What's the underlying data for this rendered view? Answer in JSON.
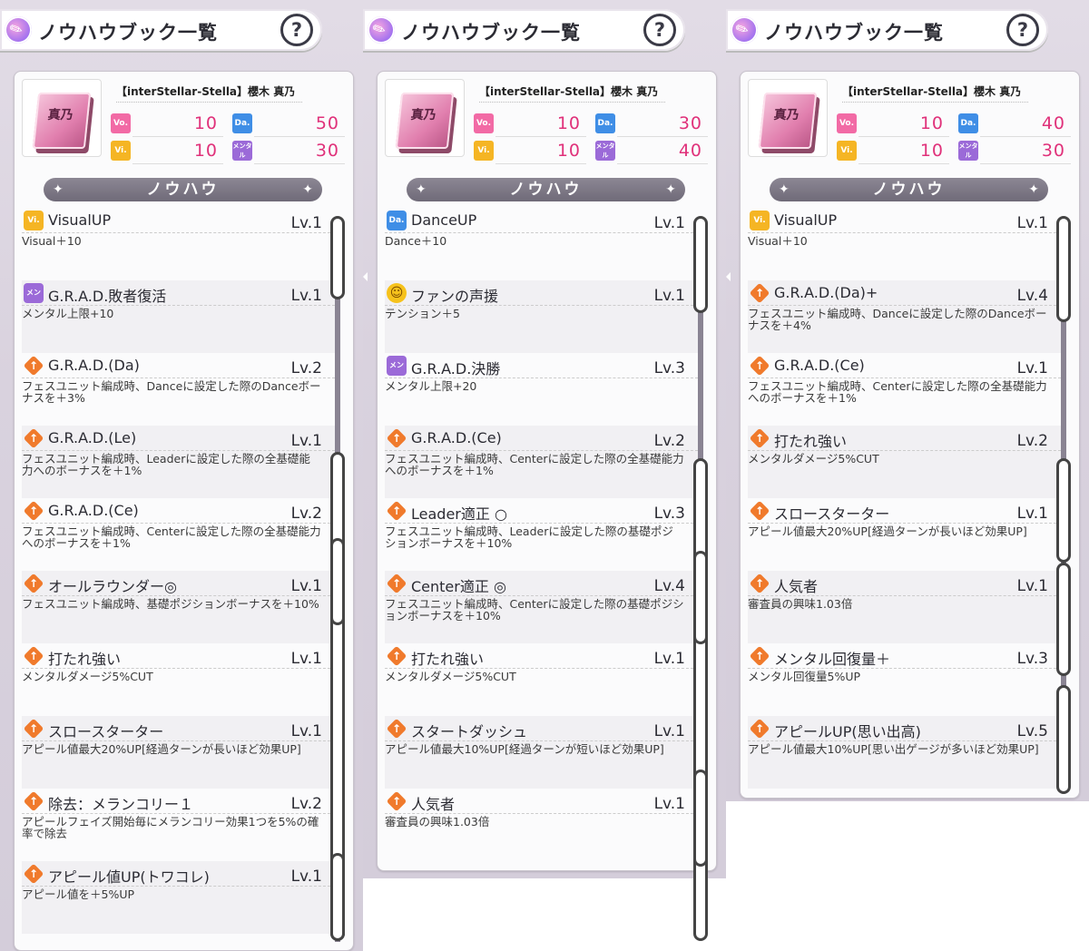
{
  "screen_title": "ノウハウブック一覧",
  "help_label": "?",
  "section_label": "ノウハウ",
  "stat_labels": {
    "vo": "Vo.",
    "da": "Da.",
    "vi": "Vi.",
    "me": "メンタル"
  },
  "colors": {
    "vocal": "#f26aa5",
    "dance": "#3f8ee6",
    "visual": "#f5b524",
    "mental": "#9b6ad8",
    "value": "#e0317a",
    "ability": "#f07a2c"
  },
  "columns": [
    {
      "book_name": "【interStellar-Stella】櫻木 真乃",
      "book_cover_text": "真乃",
      "stats": {
        "vo": "10",
        "da": "50",
        "vi": "10",
        "me": "30"
      },
      "skills": [
        {
          "icon": "visual-icon",
          "name": "VisualUP",
          "level": "Lv.1",
          "desc": "Visual＋10"
        },
        {
          "icon": "mental-icon",
          "name": "G.R.A.D.敗者復活",
          "level": "Lv.1",
          "desc": "メンタル上限+10"
        },
        {
          "icon": "ability-icon",
          "name": "G.R.A.D.(Da)",
          "level": "Lv.2",
          "desc": "フェスユニット編成時、Danceに設定した際のDanceボーナスを＋3%"
        },
        {
          "icon": "ability-icon",
          "name": "G.R.A.D.(Le)",
          "level": "Lv.1",
          "desc": "フェスユニット編成時、Leaderに設定した際の全基礎能力へのボーナスを＋1%"
        },
        {
          "icon": "ability-icon",
          "name": "G.R.A.D.(Ce)",
          "level": "Lv.2",
          "desc": "フェスユニット編成時、Centerに設定した際の全基礎能力へのボーナスを＋1%"
        },
        {
          "icon": "ability-icon",
          "name": "オールラウンダー◎",
          "level": "Lv.1",
          "desc": "フェスユニット編成時、基礎ポジションボーナスを＋10%"
        },
        {
          "icon": "ability-icon",
          "name": "打たれ強い",
          "level": "Lv.1",
          "desc": "メンタルダメージ5%CUT"
        },
        {
          "icon": "ability-icon",
          "name": "スロースターター",
          "level": "Lv.1",
          "desc": "アピール値最大20%UP[経過ターンが長いほど効果UP]"
        },
        {
          "icon": "ability-icon",
          "name": "除去：メランコリー１",
          "level": "Lv.2",
          "desc": "アピールフェイズ開始毎にメランコリー効果1つを5%の確率で除去"
        },
        {
          "icon": "ability-icon",
          "name": "アピール値UP(トワコレ)",
          "level": "Lv.1",
          "desc": "アピール値を＋5%UP"
        }
      ]
    },
    {
      "book_name": "【interStellar-Stella】櫻木 真乃",
      "book_cover_text": "真乃",
      "stats": {
        "vo": "10",
        "da": "30",
        "vi": "10",
        "me": "40"
      },
      "skills": [
        {
          "icon": "dance-icon",
          "name": "DanceUP",
          "level": "Lv.1",
          "desc": "Dance＋10"
        },
        {
          "icon": "smile-icon",
          "name": "ファンの声援",
          "level": "Lv.1",
          "desc": "テンション＋5"
        },
        {
          "icon": "mental-icon",
          "name": "G.R.A.D.決勝",
          "level": "Lv.3",
          "desc": "メンタル上限+20"
        },
        {
          "icon": "ability-icon",
          "name": "G.R.A.D.(Ce)",
          "level": "Lv.2",
          "desc": "フェスユニット編成時、Centerに設定した際の全基礎能力へのボーナスを＋1%"
        },
        {
          "icon": "ability-icon",
          "name": "Leader適正 ○",
          "level": "Lv.3",
          "desc": "フェスユニット編成時、Leaderに設定した際の基礎ポジションボーナスを＋10%"
        },
        {
          "icon": "ability-icon",
          "name": "Center適正 ◎",
          "level": "Lv.4",
          "desc": "フェスユニット編成時、Centerに設定した際の基礎ポジションボーナスを＋10%"
        },
        {
          "icon": "ability-icon",
          "name": "打たれ強い",
          "level": "Lv.1",
          "desc": "メンタルダメージ5%CUT"
        },
        {
          "icon": "ability-icon",
          "name": "スタートダッシュ",
          "level": "Lv.1",
          "desc": "アピール値最大10%UP[経過ターンが短いほど効果UP]"
        },
        {
          "icon": "ability-icon",
          "name": "人気者",
          "level": "Lv.1",
          "desc": "審査員の興味1.03倍"
        }
      ]
    },
    {
      "book_name": "【interStellar-Stella】櫻木 真乃",
      "book_cover_text": "真乃",
      "stats": {
        "vo": "10",
        "da": "40",
        "vi": "10",
        "me": "30"
      },
      "skills": [
        {
          "icon": "visual-icon",
          "name": "VisualUP",
          "level": "Lv.1",
          "desc": "Visual＋10"
        },
        {
          "icon": "ability-icon",
          "name": "G.R.A.D.(Da)+",
          "level": "Lv.4",
          "desc": "フェスユニット編成時、Danceに設定した際のDanceボーナスを＋4%"
        },
        {
          "icon": "ability-icon",
          "name": "G.R.A.D.(Ce)",
          "level": "Lv.1",
          "desc": "フェスユニット編成時、Centerに設定した際の全基礎能力へのボーナスを＋1%"
        },
        {
          "icon": "ability-icon",
          "name": "打たれ強い",
          "level": "Lv.2",
          "desc": "メンタルダメージ5%CUT"
        },
        {
          "icon": "ability-icon",
          "name": "スロースターター",
          "level": "Lv.1",
          "desc": "アピール値最大20%UP[経過ターンが長いほど効果UP]"
        },
        {
          "icon": "ability-icon",
          "name": "人気者",
          "level": "Lv.1",
          "desc": "審査員の興味1.03倍"
        },
        {
          "icon": "ability-icon",
          "name": "メンタル回復量＋",
          "level": "Lv.3",
          "desc": "メンタル回復量5%UP"
        },
        {
          "icon": "ability-icon",
          "name": "アピールUP(思い出高)",
          "level": "Lv.5",
          "desc": "アピール値最大10%UP[思い出ゲージが多いほど効果UP]"
        }
      ]
    }
  ]
}
